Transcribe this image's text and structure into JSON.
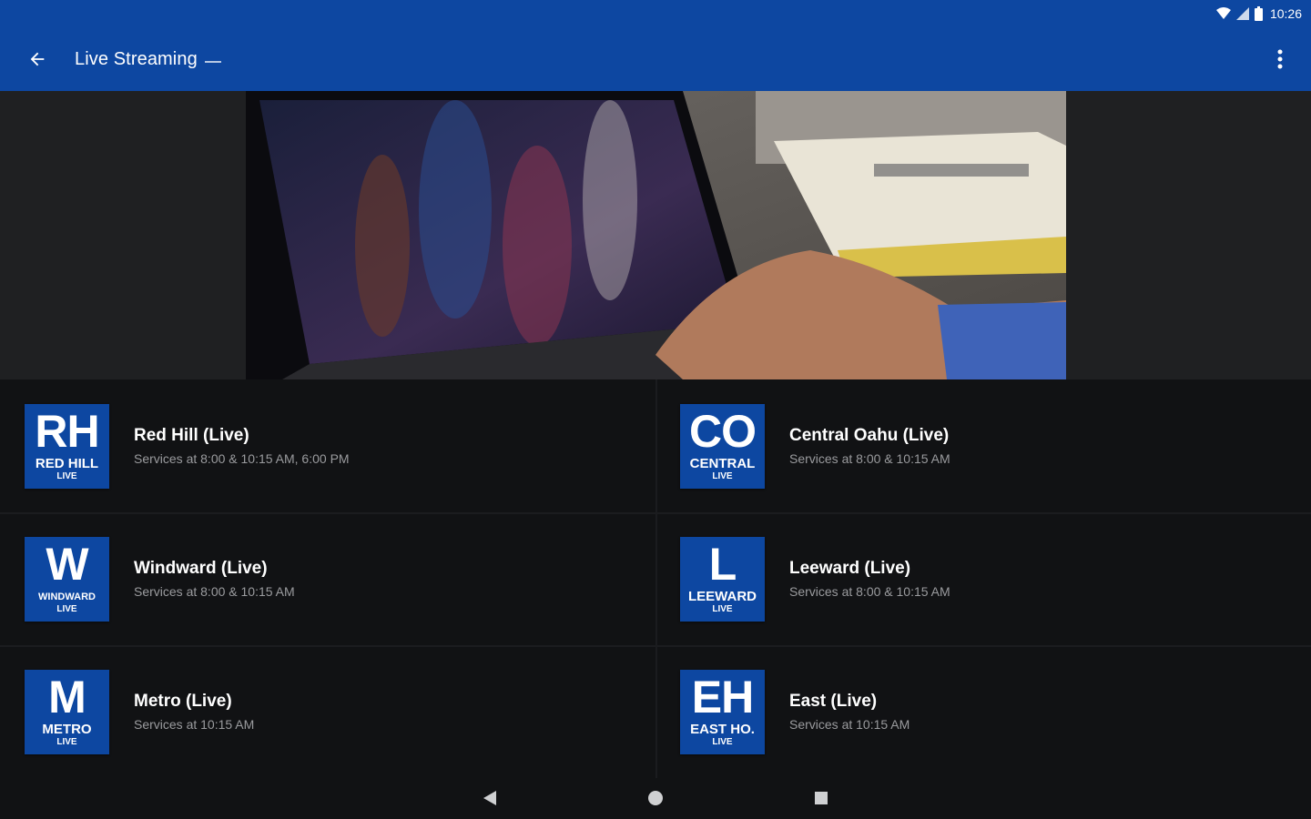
{
  "status_bar": {
    "time": "10:26"
  },
  "app_bar": {
    "title": "Live Streaming",
    "back_icon": "arrow-back-icon",
    "menu_icon": "more-vert-icon"
  },
  "colors": {
    "brand": "#0d47a1",
    "background": "#111214",
    "hero_bg": "#1f2022",
    "subtext": "#9a9b9e"
  },
  "locations": [
    {
      "abbr": "RH",
      "name": "RED HILL",
      "live": "LIVE",
      "title": "Red Hill (Live)",
      "subtitle": "Services at 8:00 & 10:15 AM, 6:00 PM"
    },
    {
      "abbr": "CO",
      "name": "CENTRAL",
      "live": "LIVE",
      "title": "Central Oahu (Live)",
      "subtitle": "Services at 8:00 & 10:15 AM"
    },
    {
      "abbr": "W",
      "name": "WINDWARD",
      "live": "LIVE",
      "title": "Windward (Live)",
      "subtitle": "Services at 8:00 & 10:15 AM"
    },
    {
      "abbr": "L",
      "name": "LEEWARD",
      "live": "LIVE",
      "title": "Leeward (Live)",
      "subtitle": "Services at 8:00 & 10:15 AM"
    },
    {
      "abbr": "M",
      "name": "METRO",
      "live": "LIVE",
      "title": "Metro (Live)",
      "subtitle": "Services at 10:15 AM"
    },
    {
      "abbr": "EH",
      "name": "EAST HO.",
      "live": "LIVE",
      "title": "East (Live)",
      "subtitle": "Services at 10:15 AM"
    }
  ],
  "nav_bar": {
    "back_icon": "nav-back-icon",
    "home_icon": "nav-home-icon",
    "recents_icon": "nav-recents-icon"
  }
}
